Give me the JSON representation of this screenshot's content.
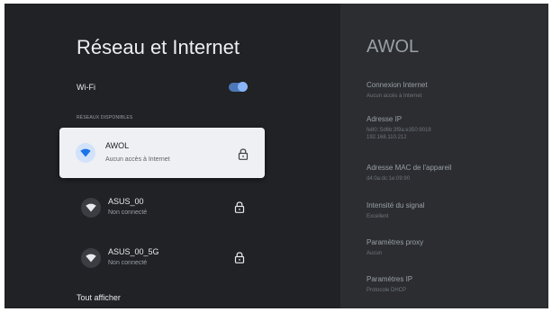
{
  "page_title": "Réseau et Internet",
  "wifi": {
    "label": "Wi-Fi",
    "enabled": true
  },
  "available_networks_label": "RÉSEAUX DISPONIBLES",
  "networks": [
    {
      "name": "AWOL",
      "status": "Aucun accès à Internet",
      "locked": true,
      "focused": true
    },
    {
      "name": "ASUS_00",
      "status": "Non connecté",
      "locked": true,
      "focused": false
    },
    {
      "name": "ASUS_00_5G",
      "status": "Non connecté",
      "locked": true,
      "focused": false
    }
  ],
  "show_all_label": "Tout afficher",
  "details": {
    "title": "AWOL",
    "items": [
      {
        "label": "Connexion Internet",
        "values": [
          "Aucun accès à Internet"
        ]
      },
      {
        "label": "Adresse IP",
        "values": [
          "fe80::5d6b:3f9a:e350:9018",
          "192.168.110.212"
        ]
      },
      {
        "label": "Adresse MAC de l'appareil",
        "values": [
          "d4:0a:dc:1e:09:90"
        ]
      },
      {
        "label": "Intensité du signal",
        "values": [
          "Excellent"
        ]
      },
      {
        "label": "Paramètres proxy",
        "values": [
          "Aucun"
        ]
      },
      {
        "label": "Paramètres IP",
        "values": [
          "Protocole DHCP"
        ]
      }
    ]
  },
  "icons": {
    "network": "wifi-icon",
    "lock": "lock-icon"
  },
  "colors": {
    "accent": "#8ab4f8",
    "toggle_track": "#4d78b8",
    "focused_card": "#eef0f3"
  }
}
